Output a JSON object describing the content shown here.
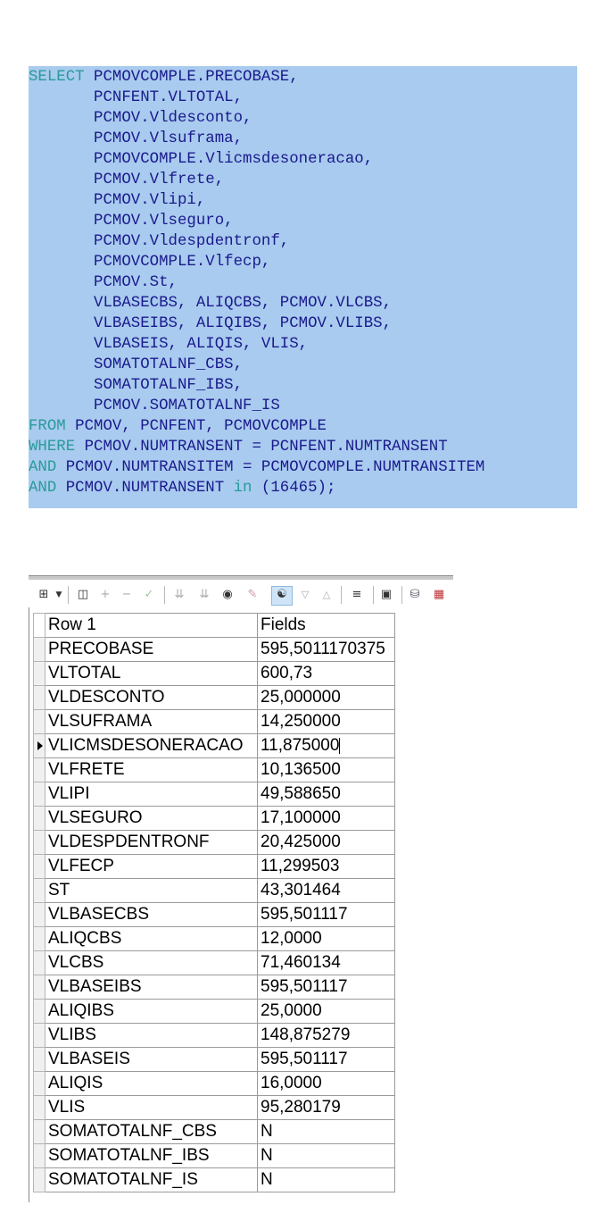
{
  "sql": {
    "lines": [
      [
        {
          "t": "SELECT",
          "k": true
        },
        {
          "t": " PCMOVCOMPLE.PRECOBASE,"
        }
      ],
      [
        {
          "t": "       PCNFENT.VLTOTAL,"
        }
      ],
      [
        {
          "t": "       PCMOV.Vldesconto,"
        }
      ],
      [
        {
          "t": "       PCMOV.Vlsuframa,"
        }
      ],
      [
        {
          "t": "       PCMOVCOMPLE.Vlicmsdesoneracao,"
        }
      ],
      [
        {
          "t": "       PCMOV.Vlfrete,"
        }
      ],
      [
        {
          "t": "       PCMOV.Vlipi,"
        }
      ],
      [
        {
          "t": "       PCMOV.Vlseguro,"
        }
      ],
      [
        {
          "t": "       PCMOV.Vldespdentronf,"
        }
      ],
      [
        {
          "t": "       PCMOVCOMPLE.Vlfecp,"
        }
      ],
      [
        {
          "t": "       PCMOV.St,"
        }
      ],
      [
        {
          "t": "       VLBASECBS, ALIQCBS, PCMOV.VLCBS,"
        }
      ],
      [
        {
          "t": "       VLBASEIBS, ALIQIBS, PCMOV.VLIBS,"
        }
      ],
      [
        {
          "t": "       VLBASEIS, ALIQIS, VLIS,"
        }
      ],
      [
        {
          "t": "       SOMATOTALNF_CBS,"
        }
      ],
      [
        {
          "t": "       SOMATOTALNF_IBS,"
        }
      ],
      [
        {
          "t": "       PCMOV.SOMATOTALNF_IS"
        }
      ],
      [
        {
          "t": "FROM",
          "k": true
        },
        {
          "t": " PCMOV, PCNFENT, PCMOVCOMPLE"
        }
      ],
      [
        {
          "t": "WHERE",
          "k": true
        },
        {
          "t": " PCMOV.NUMTRANSENT = PCNFENT.NUMTRANSENT"
        }
      ],
      [
        {
          "t": "AND",
          "k": true
        },
        {
          "t": " PCMOV.NUMTRANSITEM = PCMOVCOMPLE.NUMTRANSITEM"
        }
      ],
      [
        {
          "t": "AND",
          "k": true
        },
        {
          "t": " PCMOV.NUMTRANSENT "
        },
        {
          "t": "in",
          "k": true
        },
        {
          "t": " (16465);"
        }
      ]
    ]
  },
  "toolbar": {
    "icons": [
      "grid-layout-icon",
      "dropdown-arrow-icon",
      "lock-icon",
      "plus-icon",
      "minus-icon",
      "check-icon",
      "double-down-icon",
      "double-down-alt-icon",
      "binoculars-icon",
      "eraser-icon",
      "filter-icon",
      "triangle-down-icon",
      "triangle-up-icon",
      "tree-icon",
      "save-icon",
      "database-icon",
      "chart-icon"
    ]
  },
  "grid": {
    "header": {
      "name": "Row 1",
      "value": "Fields"
    },
    "current_row": 4,
    "rows": [
      {
        "name": "PRECOBASE",
        "value": "595,5011170375"
      },
      {
        "name": "VLTOTAL",
        "value": "600,73"
      },
      {
        "name": "VLDESCONTO",
        "value": "25,000000"
      },
      {
        "name": "VLSUFRAMA",
        "value": "14,250000"
      },
      {
        "name": "VLICMSDESONERACAO",
        "value": "11,875000"
      },
      {
        "name": "VLFRETE",
        "value": "10,136500"
      },
      {
        "name": "VLIPI",
        "value": "49,588650"
      },
      {
        "name": "VLSEGURO",
        "value": "17,100000"
      },
      {
        "name": "VLDESPDENTRONF",
        "value": "20,425000"
      },
      {
        "name": "VLFECP",
        "value": "11,299503"
      },
      {
        "name": "ST",
        "value": "43,301464"
      },
      {
        "name": "VLBASECBS",
        "value": "595,501117"
      },
      {
        "name": "ALIQCBS",
        "value": "12,0000"
      },
      {
        "name": "VLCBS",
        "value": "71,460134"
      },
      {
        "name": "VLBASEIBS",
        "value": "595,501117"
      },
      {
        "name": "ALIQIBS",
        "value": "25,0000"
      },
      {
        "name": "VLIBS",
        "value": "148,875279"
      },
      {
        "name": "VLBASEIS",
        "value": "595,501117"
      },
      {
        "name": "ALIQIS",
        "value": "16,0000"
      },
      {
        "name": "VLIS",
        "value": "95,280179"
      },
      {
        "name": "SOMATOTALNF_CBS",
        "value": "N"
      },
      {
        "name": "SOMATOTALNF_IBS",
        "value": "N"
      },
      {
        "name": "SOMATOTALNF_IS",
        "value": "N"
      }
    ]
  }
}
